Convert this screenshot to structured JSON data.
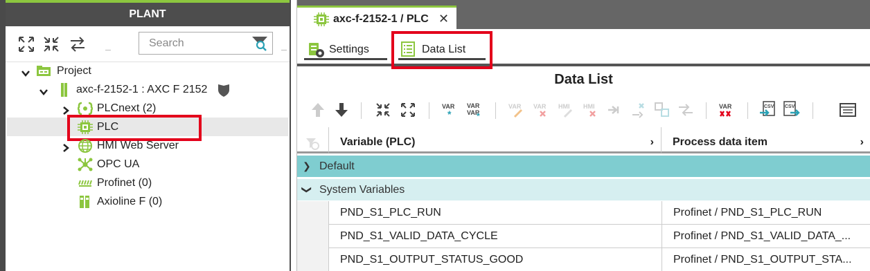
{
  "plant": {
    "title": "PLANT",
    "search_placeholder": "Search",
    "tree": {
      "project": "Project",
      "device": "axc-f-2152-1 : AXC F 2152",
      "plcnext": "PLCnext (2)",
      "plc": "PLC",
      "hmi": "HMI Web Server",
      "opcua": "OPC UA",
      "profinet": "Profinet (0)",
      "axioline": "Axioline F (0)"
    }
  },
  "editor": {
    "tab_title": "axc-f-2152-1 / PLC",
    "tab_close": "✕",
    "subtabs": {
      "settings": "Settings",
      "data_list": "Data List"
    },
    "heading": "Data List"
  },
  "grid": {
    "columns": {
      "variable": "Variable (PLC)",
      "process": "Process data item"
    },
    "col_arrow": "›",
    "groups": {
      "default": "Default",
      "system": "System Variables"
    },
    "rows": [
      {
        "variable": "PND_S1_PLC_RUN",
        "process": "Profinet / PND_S1_PLC_RUN"
      },
      {
        "variable": "PND_S1_VALID_DATA_CYCLE",
        "process": "Profinet / PND_S1_VALID_DATA_..."
      },
      {
        "variable": "PND_S1_OUTPUT_STATUS_GOOD",
        "process": "Profinet / PND_S1_OUTPUT_STA..."
      }
    ]
  },
  "colors": {
    "accent": "#8cc63f",
    "highlight": "#e3001b",
    "group_default": "#7fcdd0",
    "group_system": "#d6eff0"
  }
}
